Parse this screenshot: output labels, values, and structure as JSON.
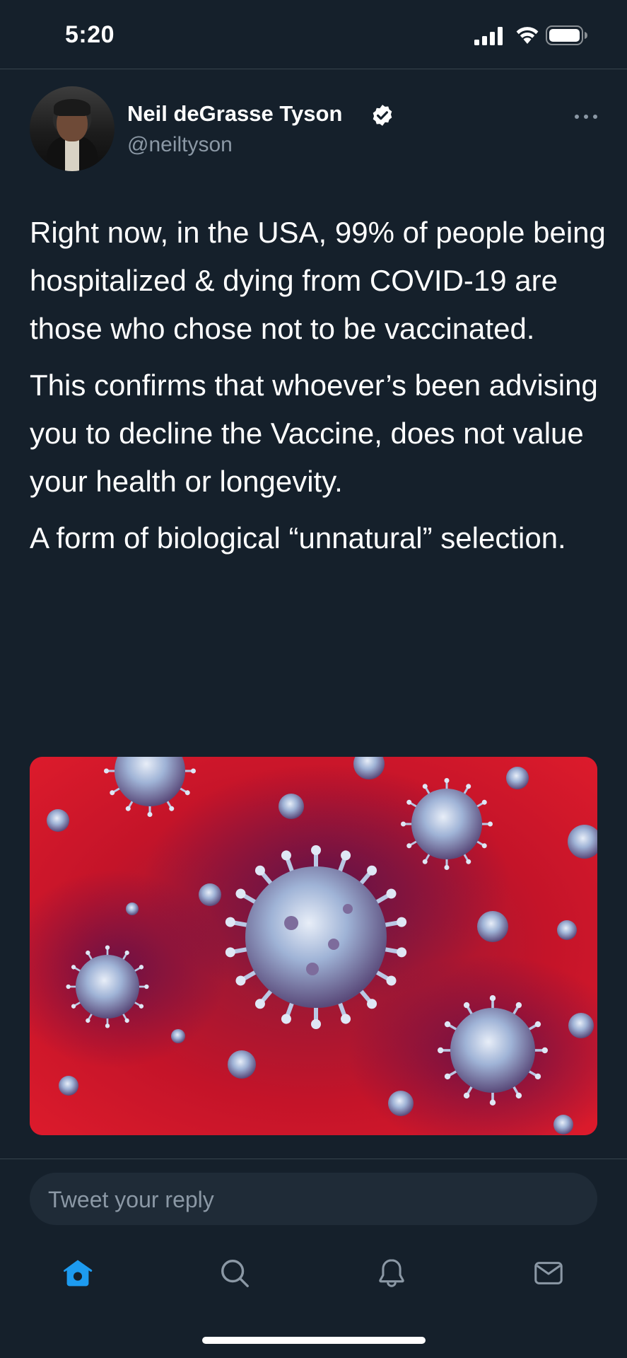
{
  "status_bar": {
    "time": "5:20"
  },
  "tweet": {
    "author_name": "Neil deGrasse Tyson",
    "author_handle": "@neiltyson",
    "paragraphs": [
      "Right now, in the USA, 99% of people being hospitalized & dying from COVID-19 are those who chose not to be vaccinated.",
      "This confirms that whoever’s been advising you to decline the Vaccine, does not value your health or longevity.",
      "A form of biological “unnatural” selection."
    ]
  },
  "reply": {
    "placeholder": "Tweet your reply"
  },
  "tab_bar": {
    "items": [
      "home-icon",
      "search-icon",
      "notifications-icon",
      "messages-icon"
    ],
    "active": "home-icon"
  },
  "colors": {
    "background": "#15202b",
    "accent": "#1d9bf0",
    "secondary_text": "#8b98a5",
    "divider": "#38444d"
  }
}
